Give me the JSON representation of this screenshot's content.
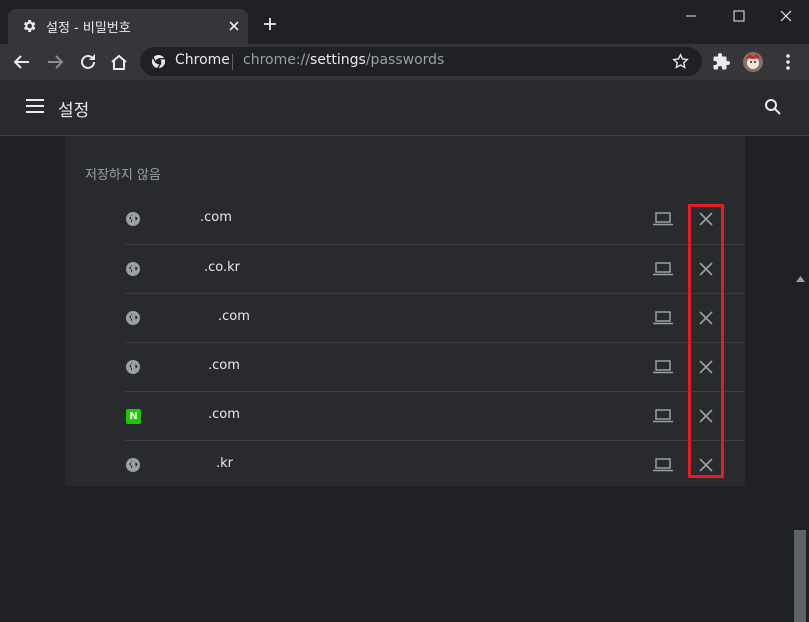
{
  "window": {
    "tab_title": "설정 - 비밀번호"
  },
  "omnibox": {
    "chip": "Chrome",
    "url_scheme": "chrome://",
    "url_host": "settings",
    "url_path": "/passwords"
  },
  "app": {
    "title": "설정"
  },
  "never_saved": {
    "heading": "저장하지 않음",
    "sites": [
      {
        "domain": ".com",
        "icon": "globe-icon"
      },
      {
        "domain": ".co.kr",
        "icon": "globe-icon"
      },
      {
        "domain": ".com",
        "icon": "globe-icon"
      },
      {
        "domain": ".com",
        "icon": "globe-icon"
      },
      {
        "domain": ".com",
        "icon": "naver-icon",
        "icon_text": "N"
      },
      {
        "domain": ".kr",
        "icon": "globe-icon"
      }
    ]
  },
  "colors": {
    "highlight": "#e01e23",
    "naver": "#1ec800"
  }
}
